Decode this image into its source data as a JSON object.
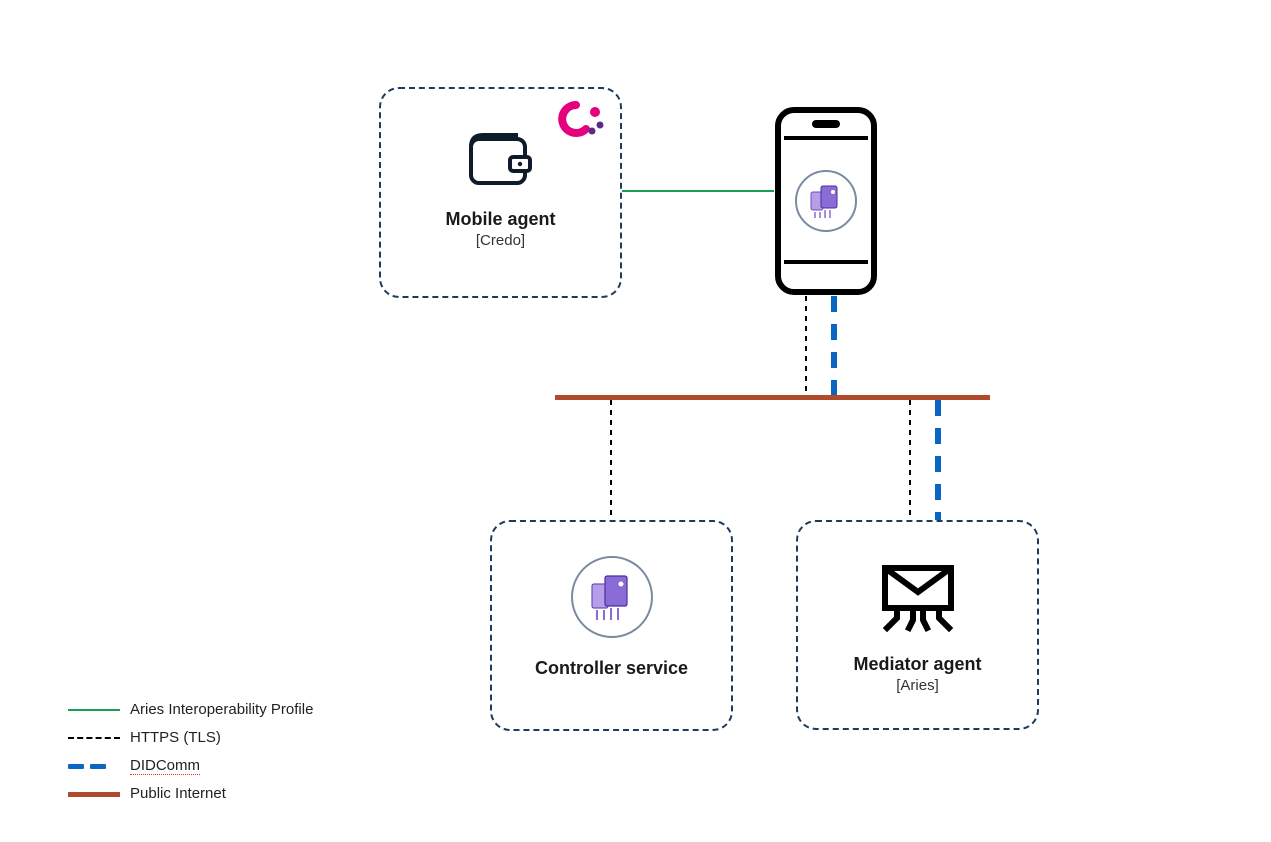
{
  "nodes": {
    "mobile_agent": {
      "title": "Mobile agent",
      "sub": "[Credo]"
    },
    "controller": {
      "title": "Controller service",
      "sub": ""
    },
    "mediator": {
      "title": "Mediator agent",
      "sub": "[Aries]"
    }
  },
  "legend": {
    "aip": "Aries Interoperability Profile",
    "https": "HTTPS (TLS)",
    "didcomm": "DIDComm",
    "internet": "Public Internet"
  },
  "colors": {
    "aip": "#1b9d55",
    "https": "#000000",
    "didcomm": "#0b66c3",
    "internet": "#b14a2c",
    "node_border": "#1d3a5f",
    "logo_pink": "#e5007e",
    "agent_purple": "#8b6bd6"
  }
}
